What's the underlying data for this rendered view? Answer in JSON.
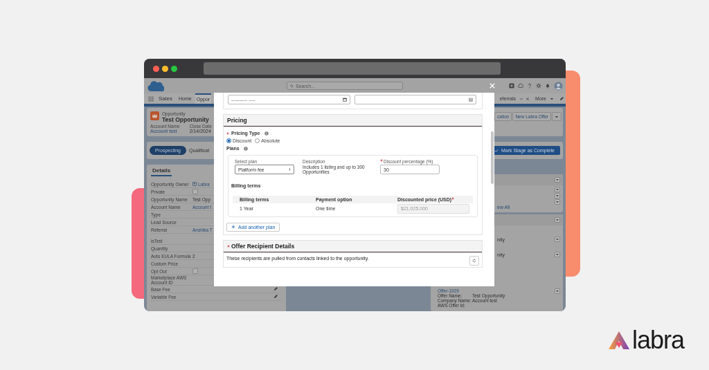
{
  "app": {
    "name": "Sales",
    "search": {
      "placeholder": "Search..."
    },
    "nav_tabs": [
      {
        "label": "Home",
        "selected": false
      },
      {
        "label": "Oppor",
        "selected": true
      }
    ],
    "nav_right": {
      "tab": "eferrals",
      "more": "More"
    }
  },
  "record": {
    "object_label": "Opportunity",
    "title": "Test Opportunity",
    "fields": [
      {
        "label": "Account Name",
        "value": "Account test"
      },
      {
        "label": "Close Date",
        "value": "2/14/2024"
      }
    ],
    "actions": [
      "cation",
      "New Labra Offer"
    ]
  },
  "path": {
    "stages": [
      {
        "label": "Prospecting",
        "selected": true
      },
      {
        "label": "Qualificat",
        "selected": false
      }
    ],
    "complete_button": "Mark Stage as Complete"
  },
  "details": {
    "tab": "Details",
    "rows": [
      {
        "label": "Opportunity Owner",
        "value": "Labra",
        "kind": "user"
      },
      {
        "label": "Private",
        "kind": "checkbox",
        "checked": false
      },
      {
        "label": "Opportunity Name",
        "value": "Test Opp",
        "kind": "text"
      },
      {
        "label": "Account Name",
        "value": "Account t",
        "kind": "link"
      },
      {
        "label": "Type",
        "kind": "text"
      },
      {
        "label": "Lead Source",
        "kind": "text"
      },
      {
        "label": "Referral",
        "value": "Anshika T",
        "kind": "link"
      },
      {
        "label": "isTest",
        "kind": "text"
      },
      {
        "label": "Quantity",
        "kind": "text"
      },
      {
        "label": "Auto EULA Formula",
        "value": "2",
        "kind": "text"
      },
      {
        "label": "Custom Price",
        "kind": "text"
      },
      {
        "label": "Opt Out",
        "kind": "checkbox",
        "checked": false
      },
      {
        "label": "Marketplace AWS Account ID",
        "kind": "text"
      },
      {
        "label": "Base Fee",
        "kind": "editable"
      },
      {
        "label": "Variable Fee",
        "kind": "editable"
      }
    ]
  },
  "related": {
    "view_all": "ew All",
    "snippets": [
      "nity",
      "nity"
    ],
    "offer": {
      "name": "Offer-1929",
      "fields": [
        {
          "label": "Offer Name:",
          "value": "Test Opportunity"
        },
        {
          "label": "Company Name:",
          "value": "Account test"
        },
        {
          "label": "AWS Offer Id:"
        }
      ]
    }
  },
  "modal": {
    "date_field": {
      "placeholder": "---------- ----"
    },
    "pricing": {
      "title": "Pricing",
      "type_label": "Pricing Type",
      "type_required": true,
      "options": [
        {
          "label": "Discount",
          "selected": true
        },
        {
          "label": "Absolute",
          "selected": false
        }
      ],
      "plans_label": "Plans",
      "plan": {
        "select_label": "Select plan",
        "select_value": "Platform fee",
        "description_label": "Description",
        "description": "Includes 1 listing and up to 300 Opportunities",
        "discount_label": "Discount percentage (%)",
        "discount_value": "30",
        "billing_title": "Billing terms",
        "columns": [
          "Billing terms",
          "Payment option",
          "Discounted price (USD)"
        ],
        "rows": [
          {
            "term": "1 Year",
            "payment": "One time",
            "price": "$21,025.000"
          }
        ]
      },
      "add_plan": "Add another plan"
    },
    "recipients": {
      "title": "Offer Recipient Details",
      "note": "These recipients are pulled from contacts linked to the opportunity."
    }
  },
  "brand": {
    "name": "labra"
  }
}
